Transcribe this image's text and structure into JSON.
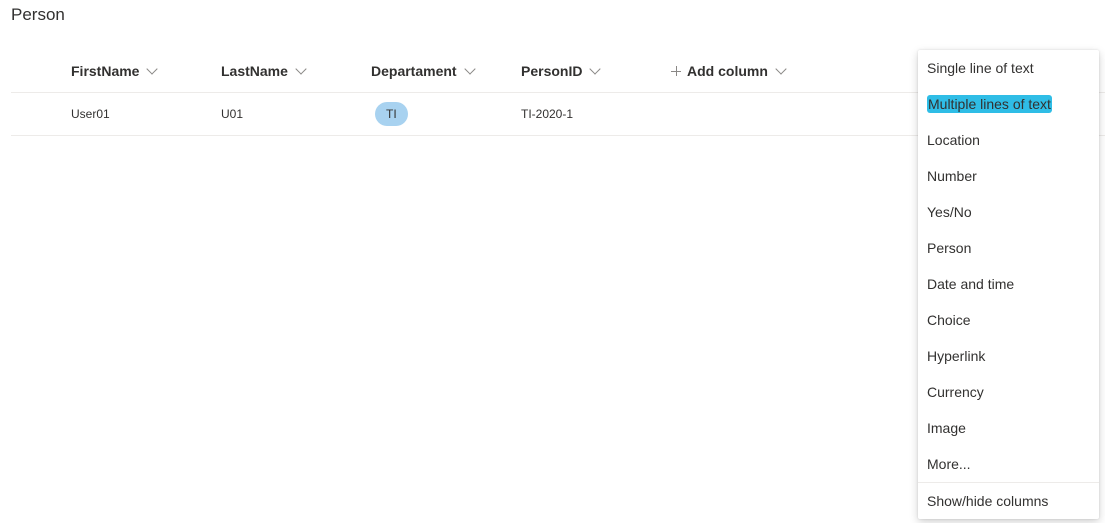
{
  "list": {
    "title": "Person"
  },
  "columns": [
    {
      "label": "FirstName"
    },
    {
      "label": "LastName"
    },
    {
      "label": "Departament"
    },
    {
      "label": "PersonID"
    }
  ],
  "add_column": {
    "label": "Add column"
  },
  "rows": [
    {
      "first_name": "User01",
      "last_name": "U01",
      "department": "TI",
      "person_id": "TI-2020-1"
    }
  ],
  "column_type_menu": {
    "items": [
      {
        "label": "Single line of text",
        "highlighted": false
      },
      {
        "label": "Multiple lines of text",
        "highlighted": true
      },
      {
        "label": "Location",
        "highlighted": false
      },
      {
        "label": "Number",
        "highlighted": false
      },
      {
        "label": "Yes/No",
        "highlighted": false
      },
      {
        "label": "Person",
        "highlighted": false
      },
      {
        "label": "Date and time",
        "highlighted": false
      },
      {
        "label": "Choice",
        "highlighted": false
      },
      {
        "label": "Hyperlink",
        "highlighted": false
      },
      {
        "label": "Currency",
        "highlighted": false
      },
      {
        "label": "Image",
        "highlighted": false
      },
      {
        "label": "More...",
        "highlighted": false
      }
    ],
    "footer_label": "Show/hide columns"
  },
  "colors": {
    "highlight": "#2fbde6",
    "department_pill": "#a8d2f0"
  }
}
